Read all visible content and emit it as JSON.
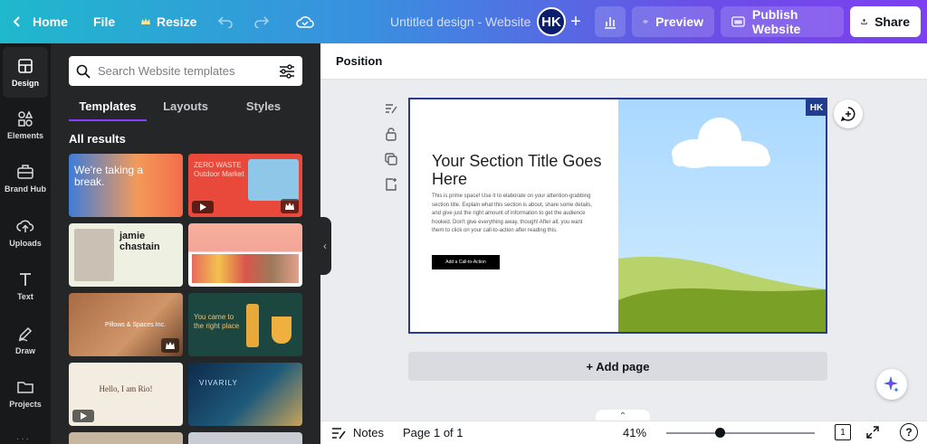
{
  "topbar": {
    "home_label": "Home",
    "file_label": "File",
    "resize_label": "Resize",
    "design_title": "Untitled design - Website",
    "avatar_initials": "HK",
    "preview_label": "Preview",
    "publish_label": "Publish Website",
    "share_label": "Share"
  },
  "rail": {
    "items": [
      {
        "label": "Design",
        "icon": "design-icon"
      },
      {
        "label": "Elements",
        "icon": "elements-icon"
      },
      {
        "label": "Brand Hub",
        "icon": "brand-hub-icon"
      },
      {
        "label": "Uploads",
        "icon": "upload-icon"
      },
      {
        "label": "Text",
        "icon": "text-icon"
      },
      {
        "label": "Draw",
        "icon": "draw-icon"
      },
      {
        "label": "Projects",
        "icon": "folder-icon"
      }
    ]
  },
  "panel": {
    "search_placeholder": "Search Website templates",
    "tabs": [
      "Templates",
      "Layouts",
      "Styles"
    ],
    "active_tab": "Templates",
    "results_heading": "All results",
    "templates": [
      {
        "text": "We're taking a break.",
        "badge": "none"
      },
      {
        "text": "ZERO WASTE Outdoor Market",
        "badge": "play-crown"
      },
      {
        "text": "jamie chastain",
        "badge": "none"
      },
      {
        "text": "",
        "badge": "none"
      },
      {
        "text": "Pillows & Spaces Inc.",
        "badge": "crown"
      },
      {
        "text": "You came to the right place",
        "badge": "none"
      },
      {
        "text": "Hello, I am Rio!",
        "badge": "play"
      },
      {
        "text": "VIVARILY",
        "badge": "none"
      }
    ]
  },
  "editor": {
    "toolbar_label": "Position",
    "canvas": {
      "title": "Your Section Title Goes Here",
      "body": "This is prime space! Use it to elaborate on your attention-grabbing section title. Explain what this section is about, share some details, and give just the right amount of information to get the audience hooked. Don't give everything away, though! After all, you want them to click on your call-to-action after reading this.",
      "cta_label": "Add a Call-to-Action",
      "badge": "HK"
    },
    "add_page_label": "+ Add page"
  },
  "bottombar": {
    "notes_label": "Notes",
    "page_indicator": "Page 1 of 1",
    "zoom": "41%",
    "zoom_slider_fraction": 0.36,
    "page_count_badge": "1",
    "help_label": "?"
  },
  "colors": {
    "topbar_gradient_start": "#1fb8cc",
    "topbar_gradient_end": "#7d3ff0",
    "accent": "#8b3dff",
    "panel_bg": "#252627",
    "rail_bg": "#18191b",
    "canvas_border": "#2a3b8f"
  }
}
